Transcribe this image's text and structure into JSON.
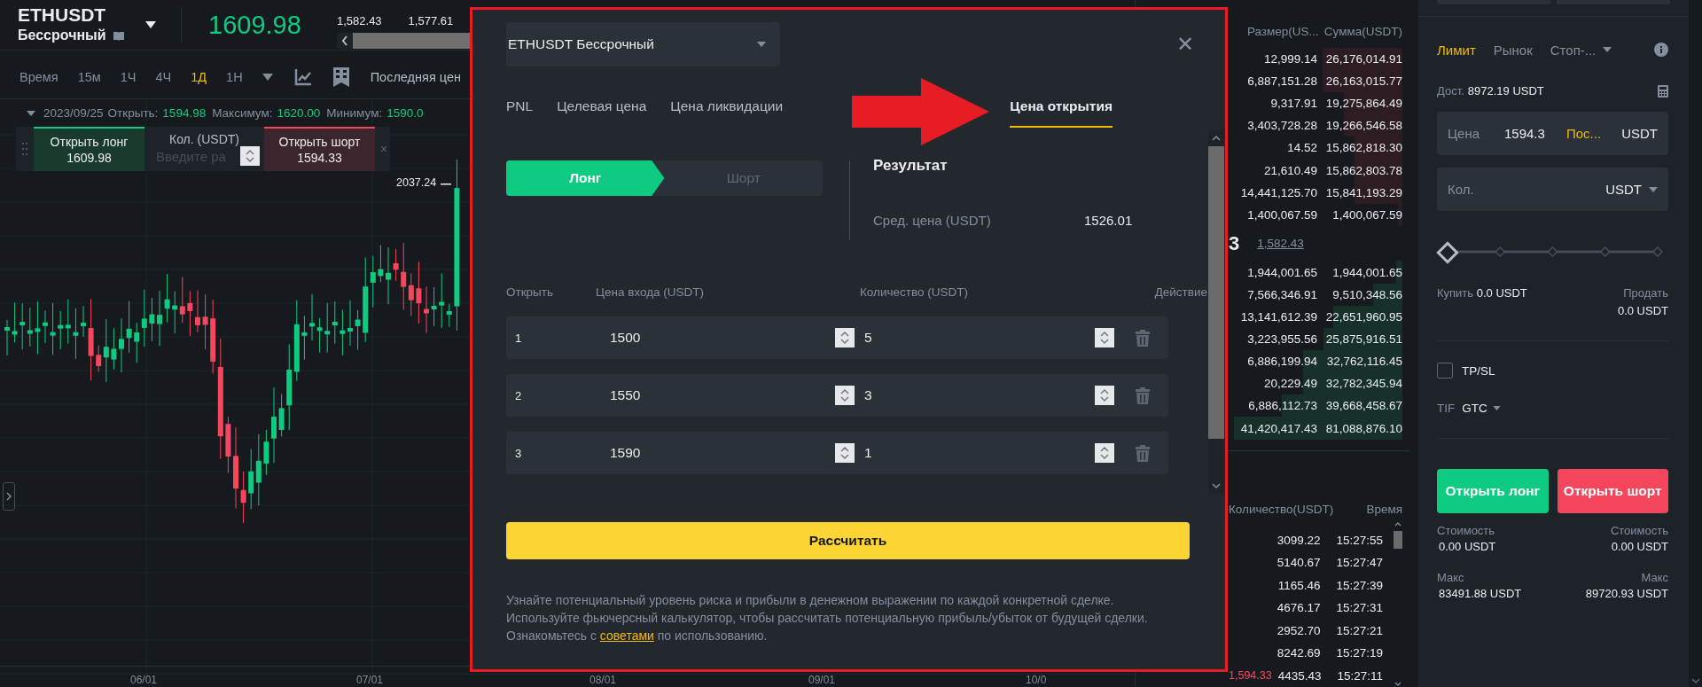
{
  "header": {
    "symbol": "ETHUSDT",
    "contract": "Бессрочный",
    "last_price": "1609.98",
    "stats": [
      "1,582.43",
      "1,577.61"
    ]
  },
  "toolbar": {
    "intervals": [
      {
        "label": "Время",
        "selected": false
      },
      {
        "label": "15м",
        "selected": false
      },
      {
        "label": "1Ч",
        "selected": false
      },
      {
        "label": "4Ч",
        "selected": false
      },
      {
        "label": "1Д",
        "selected": true
      },
      {
        "label": "1Н",
        "selected": false
      }
    ],
    "price_type": "Последняя цен"
  },
  "ohlc": {
    "date": "2023/09/25",
    "items": [
      {
        "label": "Открыть:",
        "value": "1594.98"
      },
      {
        "label": "Максимум:",
        "value": "1620.00"
      },
      {
        "label": "Минимум:",
        "value": "1590.0"
      }
    ]
  },
  "quick_trade": {
    "long_label": "Открыть лонг",
    "long_price": "1609.98",
    "qty_label": "Кол. (USDT)",
    "qty_placeholder": "Введите ра",
    "short_label": "Открыть шорт",
    "short_price": "1594.33",
    "close": "×"
  },
  "chart": {
    "high_label": "2037.24",
    "x_labels": [
      "06/01",
      "07/01",
      "08/01",
      "09/01",
      "10/0"
    ]
  },
  "calculator": {
    "symbol": "ETHUSDT Бессрочный",
    "close": "✕",
    "tabs": [
      {
        "label": "PNL",
        "selected": false
      },
      {
        "label": "Целевая цена",
        "selected": false
      },
      {
        "label": "Цена ликвидации",
        "selected": false
      },
      {
        "label": "Цена открытия",
        "selected": true
      }
    ],
    "sides": [
      {
        "label": "Лонг",
        "selected": true
      },
      {
        "label": "Шорт",
        "selected": false
      }
    ],
    "result_title": "Результат",
    "result_label": "Сред. цена (USDT)",
    "result_value": "1526.01",
    "columns": [
      "Открыть",
      "Цена входа (USDT)",
      "Количество (USDT)",
      "Действие"
    ],
    "rows": [
      {
        "index": "1",
        "price": "1500",
        "quantity": "5"
      },
      {
        "index": "2",
        "price": "1550",
        "quantity": "3"
      },
      {
        "index": "3",
        "price": "1590",
        "quantity": "1"
      }
    ],
    "button": "Рассчитать",
    "note": "Узнайте потенциальный уровень риска и прибыли в денежном выражении по каждой конкретной сделке. Используйте фьючерсный калькулятор, чтобы рассчитать потенциальную прибыль/убыток от будущей сделки. Ознакомьтесь с",
    "link": "советами",
    "note_end": "по использованию."
  },
  "order_book": {
    "columns": [
      "Размер(US...",
      "Сумма(USDT)"
    ],
    "asks": [
      {
        "size": "12,999.14",
        "total": "26,176,014.91"
      },
      {
        "size": "6,887,151.28",
        "total": "26,163,015.77"
      },
      {
        "size": "9,317.91",
        "total": "19,275,864.49"
      },
      {
        "size": "3,403,728.28",
        "total": "19,266,546.58"
      },
      {
        "size": "14.52",
        "total": "15,862,818.30"
      },
      {
        "size": "21,610.49",
        "total": "15,862,803.78"
      },
      {
        "size": "14,441,125.70",
        "total": "15,841,193.29"
      },
      {
        "size": "1,400,067.59",
        "total": "1,400,067.59"
      }
    ],
    "mid_price": "3",
    "mark_price": "1,582.43",
    "bids": [
      {
        "size": "1,944,001.65",
        "total": "1,944,001.65"
      },
      {
        "size": "7,566,346.91",
        "total": "9,510,348.56"
      },
      {
        "size": "13,141,612.39",
        "total": "22,651,960.95"
      },
      {
        "size": "3,223,955.56",
        "total": "25,875,916.51"
      },
      {
        "size": "6,886,199.94",
        "total": "32,762,116.45"
      },
      {
        "size": "20,229.49",
        "total": "32,782,345.94"
      },
      {
        "size": "6,886,112.73",
        "total": "39,668,458.67"
      },
      {
        "size": "41,420,417.43",
        "total": "81,088,876.10"
      }
    ]
  },
  "trades": {
    "columns": [
      "Количество(USDT)",
      "Время"
    ],
    "rows": [
      {
        "qty": "3099.22",
        "time": "15:27:55"
      },
      {
        "qty": "5140.67",
        "time": "15:27:47"
      },
      {
        "qty": "1165.46",
        "time": "15:27:39"
      },
      {
        "qty": "4676.17",
        "time": "15:27:31"
      },
      {
        "qty": "2952.70",
        "time": "15:27:21"
      },
      {
        "qty": "8242.69",
        "time": "15:27:19"
      },
      {
        "price": "1,594.33",
        "qty": "4435.43",
        "time": "15:27:11"
      }
    ]
  },
  "order_form": {
    "order_types": [
      {
        "label": "Лимит",
        "selected": true,
        "kind": "plain"
      },
      {
        "label": "Рынок",
        "selected": false,
        "kind": "plain"
      },
      {
        "label": "Стоп-...",
        "selected": false,
        "kind": "dropdown"
      }
    ],
    "available_label": "Дост.",
    "available_value": "8972.19 USDT",
    "price_label": "Цена",
    "price_value": "1594.3",
    "price_tag": "Пос...",
    "price_unit": "USDT",
    "qty_label": "Кол.",
    "qty_unit": "USDT",
    "slider": {
      "level": 0
    },
    "buy_label": "Купить",
    "buy_value": "0.0 USDT",
    "sell_label": "Продать",
    "sell_value": "0.0 USDT",
    "tpsl": {
      "label": "TP/SL",
      "checked": false
    },
    "tif_label": "TIF",
    "tif_value": "GTC",
    "long_button": "Открыть лонг",
    "short_button": "Открыть шорт",
    "cost_label_long": "Стоимость",
    "cost_long": "0.00 USDT",
    "cost_label_short": "Стоимость",
    "cost_short": "0.00 USDT",
    "max_label_long": "Макс",
    "max_long": "83491.88 USDT",
    "max_label_short": "Макс",
    "max_short": "89720.93 USDT"
  }
}
